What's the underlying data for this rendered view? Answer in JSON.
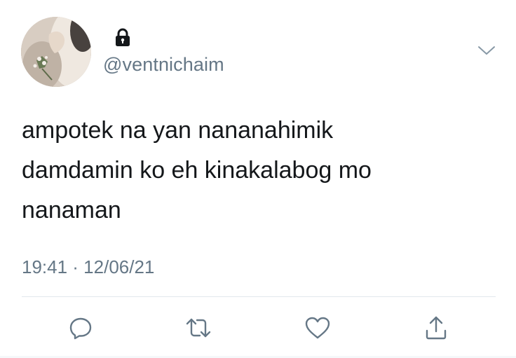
{
  "user": {
    "handle": "@ventnichaim",
    "protected": true,
    "avatar_icon": "profile-photo",
    "lock_icon": "lock-icon"
  },
  "tweet": {
    "lines": [
      "ampotek na yan nananahimik",
      "damdamin ko eh kinakalabog mo",
      "nanaman"
    ],
    "timestamp": "19:41 · 12/06/21"
  },
  "actions": {
    "reply_icon": "reply-icon",
    "retweet_icon": "retweet-icon",
    "like_icon": "like-icon",
    "share_icon": "share-icon",
    "menu_icon": "chevron-down-icon"
  },
  "colors": {
    "text": "#14171a",
    "secondary": "#657786",
    "divider": "#e1e8ed",
    "icon": "#657786"
  }
}
